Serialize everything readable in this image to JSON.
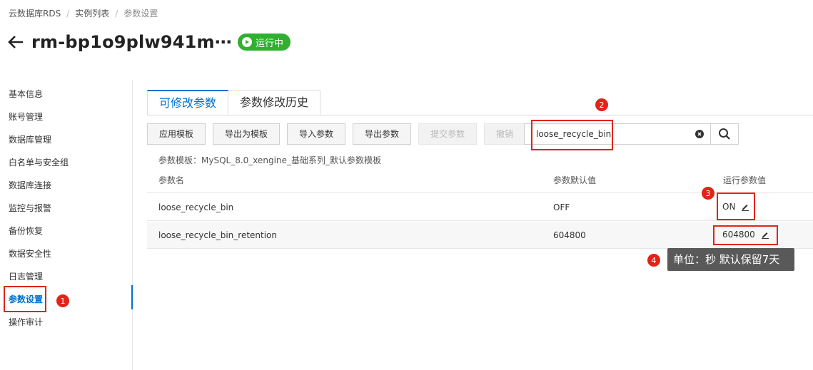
{
  "breadcrumb": {
    "items": [
      "云数据库RDS",
      "实例列表",
      "参数设置"
    ],
    "separator": "/"
  },
  "header": {
    "title": "rm-bp1o9plw941m⋯",
    "status": "运行中"
  },
  "sidebar": {
    "items": [
      "基本信息",
      "账号管理",
      "数据库管理",
      "白名单与安全组",
      "数据库连接",
      "监控与报警",
      "备份恢复",
      "数据安全性",
      "日志管理",
      "参数设置",
      "操作审计"
    ],
    "active_index": 9
  },
  "tabs": [
    "可修改参数",
    "参数修改历史"
  ],
  "toolbar": {
    "buttons": [
      "应用模板",
      "导出为模板",
      "导入参数",
      "导出参数",
      "提交参数",
      "撤销"
    ]
  },
  "search": {
    "value": "loose_recycle_bin"
  },
  "template_info": "参数模板：MySQL_8.0_xengine_基础系列_默认参数模板",
  "table": {
    "headers": [
      "参数名",
      "参数默认值",
      "运行参数值"
    ],
    "rows": [
      {
        "name": "loose_recycle_bin",
        "default": "OFF",
        "running": "ON"
      },
      {
        "name": "loose_recycle_bin_retention",
        "default": "604800",
        "running": "604800"
      }
    ]
  },
  "annotations": {
    "badges": [
      "1",
      "2",
      "3",
      "4"
    ],
    "tooltip": "单位：秒 默认保留7天"
  },
  "colors": {
    "accent": "#0070cc",
    "status_green": "#2fb12f",
    "annotation_red": "#e2231a",
    "tooltip_bg": "#595959"
  },
  "icons": [
    "back-arrow-icon",
    "play-icon",
    "clear-icon",
    "search-icon",
    "edit-icon"
  ]
}
